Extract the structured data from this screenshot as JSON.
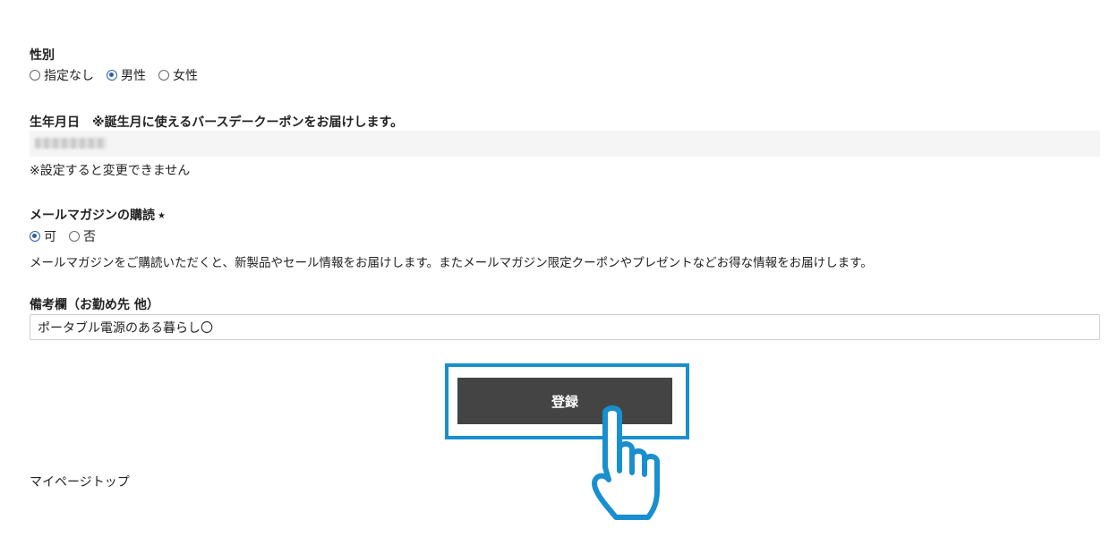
{
  "gender": {
    "label": "性別",
    "options": [
      {
        "label": "指定なし",
        "checked": false
      },
      {
        "label": "男性",
        "checked": true
      },
      {
        "label": "女性",
        "checked": false
      }
    ]
  },
  "birthday": {
    "label": "生年月日　※誕生月に使えるバースデークーポンをお届けします。",
    "note": "※設定すると変更できません"
  },
  "newsletter": {
    "label": "メールマガジンの購読",
    "required_mark": "★",
    "options": [
      {
        "label": "可",
        "checked": true
      },
      {
        "label": "否",
        "checked": false
      }
    ],
    "description": "メールマガジンをご購読いただくと、新製品やセール情報をお届けします。またメールマガジン限定クーポンやプレゼントなどお得な情報をお届けします。"
  },
  "remarks": {
    "label": "備考欄（お勤め先 他）",
    "value": "ポータブル電源のある暮らし〇"
  },
  "submit": {
    "label": "登録"
  },
  "footer": {
    "mypage_link": "マイページトップ"
  },
  "colors": {
    "accent_radio": "#2f5fa8",
    "highlight": "#1a8fd0",
    "button_bg": "#444444"
  },
  "icons": {
    "pointer": "hand-pointer-icon"
  }
}
